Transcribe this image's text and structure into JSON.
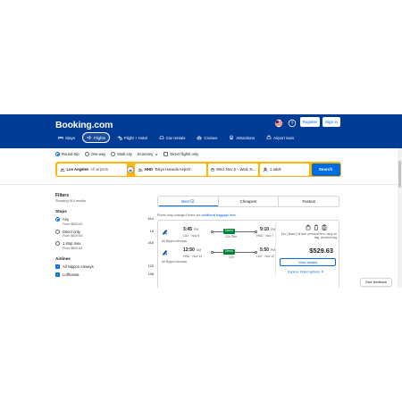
{
  "header": {
    "logo": "Booking.com",
    "register_label": "Register",
    "signin_label": "Sign in",
    "nav": [
      {
        "label": "Stays",
        "icon": "bed-icon"
      },
      {
        "label": "Flights",
        "icon": "plane-icon",
        "active": true
      },
      {
        "label": "Flight + Hotel",
        "icon": "plane-hotel-icon"
      },
      {
        "label": "Car rentals",
        "icon": "car-icon"
      },
      {
        "label": "Cruises",
        "icon": "ship-icon"
      },
      {
        "label": "Attractions",
        "icon": "ferris-wheel-icon"
      },
      {
        "label": "Airport taxis",
        "icon": "taxi-icon"
      }
    ]
  },
  "search": {
    "trip_types": [
      "Round-trip",
      "One-way",
      "Multi-city"
    ],
    "selected_trip": "Round-trip",
    "cabin": "Economy",
    "direct_only_label": "Direct flights only",
    "from_code": "Los Angeles",
    "from_detail": "All airports",
    "to_code": "HND",
    "to_detail": "Tokyo Haneda Airport",
    "dates": "Wed, Nov 6 – Wed, N...",
    "travelers": "1 adult",
    "search_label": "Search"
  },
  "filters": {
    "title": "Filters",
    "subtitle": "Showing 614 results",
    "stops_title": "Stops",
    "stops": [
      {
        "label": "Any",
        "price": "From $529.63",
        "count": "614",
        "selected": true
      },
      {
        "label": "Direct only",
        "price": "From $529.63",
        "count": "16"
      },
      {
        "label": "1 stop max",
        "price": "From $529.63",
        "count": "416"
      }
    ],
    "airlines_title": "Airlines",
    "airlines": [
      {
        "label": "All Nippon Airways",
        "count": "120",
        "checked": true
      },
      {
        "label": "Lufthansa",
        "count": "108",
        "checked": true
      }
    ]
  },
  "results": {
    "tabs": [
      "Best",
      "Cheapest",
      "Fastest"
    ],
    "notice_text": "Prices may change if there are ",
    "notice_link": "additional baggage fees",
    "card": {
      "outbound": {
        "depart_time": "3:45",
        "depart_suffix": "PM",
        "depart_sub": "LAX · Nov 6",
        "arrive_time": "9:10",
        "arrive_suffix": "PM",
        "arrive_sub": "HND · Nov 7",
        "badge": "Direct",
        "duration": "12h 25m",
        "airline": "All Nippon Airways"
      },
      "inbound": {
        "depart_time": "12:50",
        "depart_suffix": "AM",
        "depart_sub": "HND · Nov 13",
        "arrive_time": "5:50",
        "arrive_suffix": "PM",
        "arrive_sub": "LAX · Nov 12",
        "badge": "Direct",
        "duration": "10h",
        "airline": "All Nippon Airways"
      },
      "fare_info": "Eco | Basic | Ni fare: personal item, carry-on bag, checked bag",
      "price": "$529.63",
      "view_details": "View details",
      "explore": "Explore ticket options"
    },
    "feedback": "Give feedback"
  },
  "colors": {
    "brand": "#003b95",
    "accent": "#006ce4",
    "search_border": "#ffb700",
    "direct_badge": "#008234"
  }
}
